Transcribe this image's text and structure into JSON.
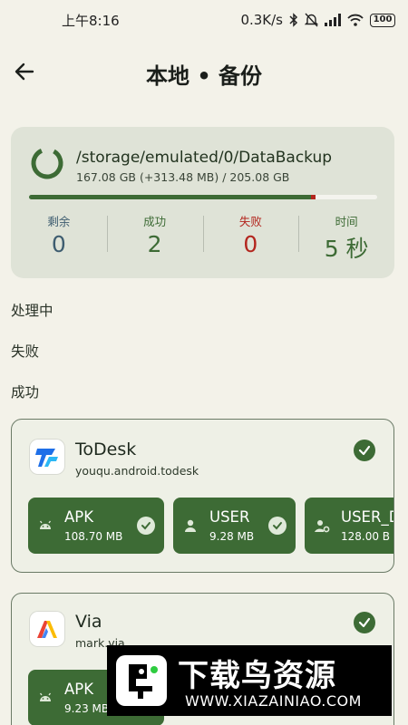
{
  "status_bar": {
    "time": "上午8:16",
    "network_speed": "0.3K/s",
    "battery": "100"
  },
  "header": {
    "title": "本地 • 备份"
  },
  "summary": {
    "path": "/storage/emulated/0/DataBackup",
    "size_info": "167.08 GB (+313.48 MB) / 205.08 GB",
    "progress_used": 0.81,
    "stats": [
      {
        "label": "剩余",
        "value": "0"
      },
      {
        "label": "成功",
        "value": "2"
      },
      {
        "label": "失败",
        "value": "0"
      },
      {
        "label": "时间",
        "value": "5 秒"
      }
    ]
  },
  "sections": {
    "processing": "处理中",
    "failed": "失败",
    "success": "成功"
  },
  "apps": [
    {
      "name": "ToDesk",
      "package": "youqu.android.todesk",
      "chips": [
        {
          "label": "APK",
          "size": "108.70 MB"
        },
        {
          "label": "USER",
          "size": "9.28 MB"
        },
        {
          "label": "USER_DE",
          "size": "128.00 B"
        }
      ]
    },
    {
      "name": "Via",
      "package": "mark.via",
      "chips": [
        {
          "label": "APK",
          "size": "9.23 MB"
        }
      ]
    }
  ],
  "watermark": {
    "title": "下载鸟资源",
    "url": "WWW.XIAZAINIAO.COM"
  },
  "colors": {
    "background": "#f3f2e9",
    "card": "#dfe3d7",
    "accent_green": "#3d6b35",
    "error_red": "#b3261e",
    "remaining_blue": "#3e5d70"
  }
}
